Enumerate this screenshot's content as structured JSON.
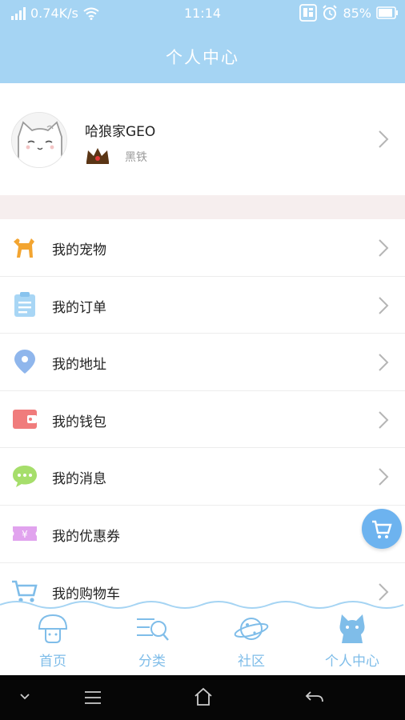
{
  "status_bar": {
    "speed": "0.74K/s",
    "time": "11:14",
    "battery": "85%"
  },
  "header": {
    "title": "个人中心"
  },
  "profile": {
    "username": "哈狼家GEO",
    "level": "黑铁"
  },
  "menu": {
    "items": [
      {
        "label": "我的宠物",
        "icon": "dog-icon"
      },
      {
        "label": "我的订单",
        "icon": "clipboard-icon"
      },
      {
        "label": "我的地址",
        "icon": "location-pin-icon"
      },
      {
        "label": "我的钱包",
        "icon": "wallet-icon"
      },
      {
        "label": "我的消息",
        "icon": "chat-bubble-icon"
      },
      {
        "label": "我的优惠券",
        "icon": "coupon-icon",
        "icon_text": "¥"
      },
      {
        "label": "我的购物车",
        "icon": "cart-icon"
      }
    ]
  },
  "tabs": [
    {
      "label": "首页",
      "icon": "mushroom-icon"
    },
    {
      "label": "分类",
      "icon": "category-search-icon"
    },
    {
      "label": "社区",
      "icon": "planet-icon"
    },
    {
      "label": "个人中心",
      "icon": "cat-icon"
    }
  ],
  "colors": {
    "header": "#a5d4f3",
    "tab_text": "#7fbde9",
    "fab": "#6db3ef",
    "divider_band": "#f6eeee"
  }
}
